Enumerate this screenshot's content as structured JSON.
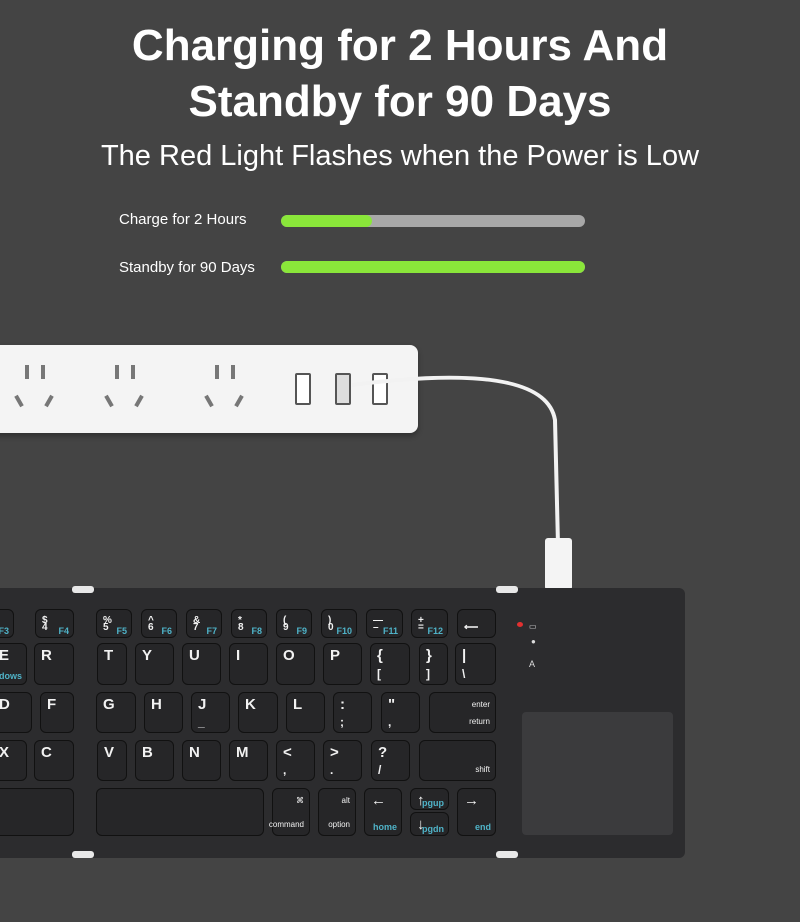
{
  "header": {
    "title_line1": "Charging for 2 Hours And",
    "title_line2": "Standby for 90 Days",
    "subtitle": "The Red Light Flashes when the Power is Low"
  },
  "bars": [
    {
      "label": "Charge for 2 Hours",
      "progress_percent": 30
    },
    {
      "label": "Standby for 90 Days",
      "progress_percent": 100
    }
  ],
  "colors": {
    "background": "#444444",
    "bar_fill": "#8ae63a",
    "bar_track": "#a8a8a8",
    "fn_label": "#4fb3c8",
    "indicator": "#e23030"
  },
  "keyboard": {
    "rows": [
      [
        {
          "t": "",
          "b": "",
          "f": "F3"
        },
        {
          "t": "$",
          "b": "4",
          "f": "F4"
        },
        {
          "t": "%",
          "b": "5",
          "f": "F5"
        },
        {
          "t": "^",
          "b": "6",
          "f": "F6"
        },
        {
          "t": "&",
          "b": "7",
          "f": "F7"
        },
        {
          "t": "*",
          "b": "8",
          "f": "F8"
        },
        {
          "t": "(",
          "b": "9",
          "f": "F9"
        },
        {
          "t": ")",
          "b": "0",
          "f": "F10"
        },
        {
          "t": "—",
          "b": "–",
          "f": "F11"
        },
        {
          "t": "+",
          "b": "=",
          "f": "F12"
        },
        {
          "t": "",
          "b": "⟵",
          "f": ""
        }
      ],
      [
        {
          "t": "E",
          "b": "",
          "f": "ndows"
        },
        {
          "t": "R",
          "b": "",
          "f": ""
        },
        {
          "t": "T",
          "b": "",
          "f": ""
        },
        {
          "t": "Y",
          "b": "",
          "f": ""
        },
        {
          "t": "U",
          "b": "",
          "f": ""
        },
        {
          "t": "I",
          "b": "",
          "f": ""
        },
        {
          "t": "O",
          "b": "",
          "f": ""
        },
        {
          "t": "P",
          "b": "",
          "f": ""
        },
        {
          "t": "{",
          "b": "[",
          "f": ""
        },
        {
          "t": "}",
          "b": "]",
          "f": ""
        },
        {
          "t": "|",
          "b": "\\",
          "f": ""
        }
      ],
      [
        {
          "t": "D",
          "b": "",
          "f": ""
        },
        {
          "t": "F",
          "b": "",
          "f": ""
        },
        {
          "t": "G",
          "b": "",
          "f": ""
        },
        {
          "t": "H",
          "b": "",
          "f": ""
        },
        {
          "t": "J",
          "b": "_",
          "f": ""
        },
        {
          "t": "K",
          "b": "",
          "f": ""
        },
        {
          "t": "L",
          "b": "",
          "f": ""
        },
        {
          "t": ":",
          "b": ";",
          "f": ""
        },
        {
          "t": "\"",
          "b": ",",
          "f": ""
        },
        {
          "t": "enter",
          "b": "return",
          "f": "",
          "mod": true
        }
      ],
      [
        {
          "t": "X",
          "b": "",
          "f": ""
        },
        {
          "t": "C",
          "b": "",
          "f": ""
        },
        {
          "t": "V",
          "b": "",
          "f": ""
        },
        {
          "t": "B",
          "b": "",
          "f": ""
        },
        {
          "t": "N",
          "b": "",
          "f": ""
        },
        {
          "t": "M",
          "b": "",
          "f": ""
        },
        {
          "t": "<",
          "b": ",",
          "f": ""
        },
        {
          "t": ">",
          "b": ".",
          "f": ""
        },
        {
          "t": "?",
          "b": "/",
          "f": ""
        },
        {
          "t": "",
          "b": "shift",
          "f": "",
          "mod": true
        }
      ],
      [
        {
          "t": "",
          "b": "",
          "f": ""
        },
        {
          "t": "",
          "b": "",
          "f": ""
        },
        {
          "t": "⌘",
          "b": "command",
          "f": "",
          "mod": true
        },
        {
          "t": "alt",
          "b": "option",
          "f": "",
          "mod": true
        },
        {
          "t": "←",
          "b": "",
          "f": "home"
        },
        {
          "t": "↑",
          "b": "",
          "f": "pgup"
        },
        {
          "t": "↓",
          "b": "",
          "f": "pgdn"
        },
        {
          "t": "→",
          "b": "",
          "f": "end"
        }
      ]
    ]
  }
}
